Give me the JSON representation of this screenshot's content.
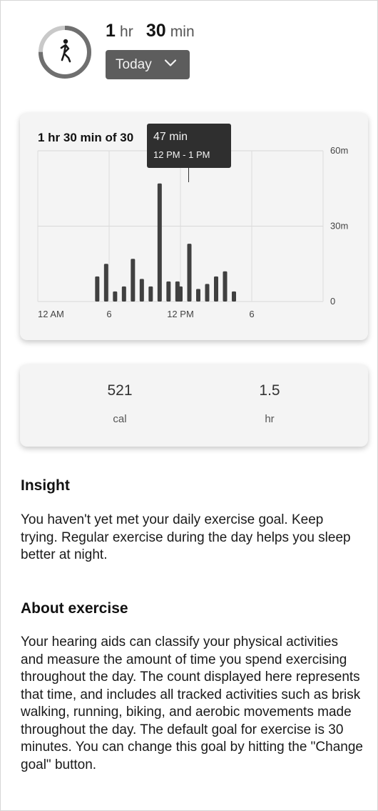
{
  "summary": {
    "hours_value": "1",
    "hours_unit": "hr",
    "minutes_value": "30",
    "minutes_unit": "min",
    "ring_progress": 0.75,
    "activity_icon": "person-exercising-icon"
  },
  "period_select": {
    "selected": "Today",
    "icon": "chevron-down-icon"
  },
  "chart_card": {
    "title": "1 hr 30 min of 30",
    "tooltip": {
      "value": "47 min",
      "range": "12 PM - 1 PM"
    }
  },
  "chart_data": {
    "type": "bar",
    "title": "",
    "xlabel": "",
    "ylabel": "",
    "x_tick_labels": [
      "12 AM",
      "6",
      "12 PM",
      "6"
    ],
    "y_tick_labels": [
      "60m",
      "30m",
      "0"
    ],
    "ylim": [
      0,
      60
    ],
    "grid": true,
    "highlighted_bar_x": "12:00 PM",
    "x": [
      "5:00 AM",
      "5:45 AM",
      "6:30 AM",
      "7:15 AM",
      "8:00 AM",
      "8:45 AM",
      "9:30 AM",
      "10:15 AM",
      "11:00 AM",
      "11:45 AM",
      "12:00 PM",
      "12:45 PM",
      "1:30 PM",
      "2:15 PM",
      "3:00 PM",
      "3:45 PM",
      "4:30 PM",
      "6:00 PM",
      "6:45 PM",
      "7:30 PM"
    ],
    "values": [
      10,
      15,
      4,
      6,
      17,
      9,
      6,
      47,
      8,
      8,
      6,
      23,
      5,
      7,
      10,
      12,
      4,
      0,
      0,
      0
    ]
  },
  "stats": {
    "calories_value": "521",
    "calories_label": "cal",
    "hours_value": "1.5",
    "hours_label": "hr"
  },
  "insight": {
    "title": "Insight",
    "body": "You haven't yet met your daily exercise goal. Keep trying. Regular exercise during the day helps you sleep better at night."
  },
  "about": {
    "title": "About exercise",
    "body": "Your hearing aids can classify your physical activities and measure the amount of time you spend exercising throughout the day. The count displayed here represents that time, and includes all tracked activities such as brisk walking, running, biking, and aerobic movements made throughout the day. The default goal for exercise is 30 minutes. You can change this goal by hitting the \"Change goal\" button."
  }
}
